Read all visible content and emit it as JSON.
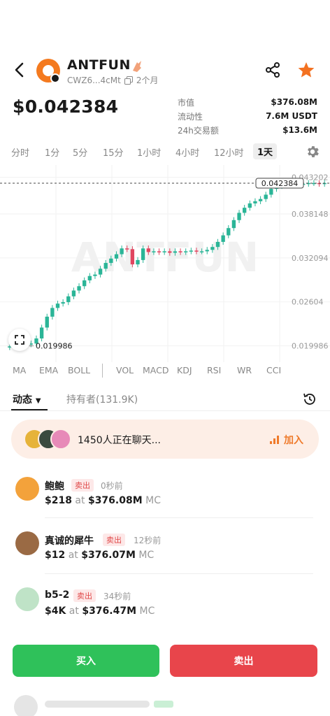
{
  "header": {
    "token_name": "ANTFUN",
    "address": "CWZ6...4cMt",
    "age": "2个月",
    "icons": [
      "back-icon",
      "fire-icon",
      "copy-icon",
      "share-icon",
      "star-icon"
    ]
  },
  "price": "$0.042384",
  "stats": [
    {
      "label": "市值",
      "value": "$376.08M"
    },
    {
      "label": "流动性",
      "value": "7.6M USDT"
    },
    {
      "label": "24h交易额",
      "value": "$13.6M"
    }
  ],
  "intervals": [
    "分时",
    "1分",
    "5分",
    "15分",
    "1小时",
    "4小时",
    "12小时",
    "1天"
  ],
  "active_interval": "1天",
  "indicators": [
    "MA",
    "EMA",
    "BOLL",
    "VOL",
    "MACD",
    "KDJ",
    "RSI",
    "WR",
    "CCI"
  ],
  "tabs": {
    "activity": "动态",
    "holders": "持有者(131.9K)"
  },
  "chat": {
    "text": "1450人正在聊天...",
    "join": "加入"
  },
  "trades": [
    {
      "name": "鲍鲍",
      "side": "卖出",
      "ago": "0秒前",
      "amount": "$218",
      "at": "at",
      "mcap": "$376.08M",
      "mc": "MC"
    },
    {
      "name": "真诚的犀牛",
      "side": "卖出",
      "ago": "12秒前",
      "amount": "$12",
      "at": "at",
      "mcap": "$376.07M",
      "mc": "MC"
    },
    {
      "name": "b5-2",
      "side": "卖出",
      "ago": "34秒前",
      "amount": "$4K",
      "at": "at",
      "mcap": "$376.47M",
      "mc": "MC"
    }
  ],
  "actions": {
    "buy": "买入",
    "sell": "卖出"
  },
  "chart_data": {
    "type": "candlestick",
    "watermark": "ANTFUN",
    "y_ticks": [
      "0.043202",
      "0.038148",
      "0.032094",
      "0.02604",
      "0.019986"
    ],
    "y_tick_values": [
      0.043202,
      0.038148,
      0.032094,
      0.02604,
      0.019986
    ],
    "ylim": [
      0.0185,
      0.0445
    ],
    "current_price_label": "0.042384",
    "current_price": 0.042384,
    "min_label": "0.019986",
    "min_value": 0.019986,
    "up_color": "#2ab597",
    "down_color": "#e04660",
    "close_values": [
      0.0199,
      0.02,
      0.0201,
      0.0202,
      0.0203,
      0.021,
      0.0225,
      0.024,
      0.0252,
      0.0258,
      0.026,
      0.0268,
      0.0276,
      0.0282,
      0.029,
      0.0296,
      0.0298,
      0.0306,
      0.0314,
      0.032,
      0.0326,
      0.0334,
      0.0333,
      0.0312,
      0.0318,
      0.0334,
      0.0329,
      0.033,
      0.0329,
      0.033,
      0.0328,
      0.033,
      0.0329,
      0.033,
      0.0331,
      0.033,
      0.033,
      0.0332,
      0.0336,
      0.0343,
      0.0352,
      0.0362,
      0.0373,
      0.0383,
      0.039,
      0.0396,
      0.0399,
      0.0402,
      0.0408,
      0.0416,
      0.042,
      0.0421,
      0.0422,
      0.0422,
      0.0423,
      0.0423,
      0.0424,
      0.0424,
      0.0423,
      0.0424
    ]
  }
}
